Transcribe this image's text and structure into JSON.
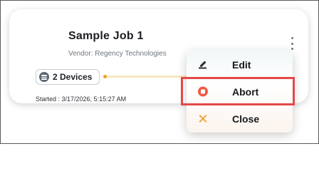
{
  "job": {
    "title": "Sample Job 1",
    "vendor": "Vendor: Regency Technologies",
    "devices_label": "2 Devices",
    "started": "Started : 3/17/2026, 5:15:27 AM",
    "progress_fraction": 0.0
  },
  "menu": {
    "items": [
      {
        "label": "Edit",
        "icon": "pencil-icon"
      },
      {
        "label": "Abort",
        "icon": "stop-circle-icon",
        "highlighted": true
      },
      {
        "label": "Close",
        "icon": "close-icon"
      }
    ]
  },
  "colors": {
    "card_shadow": "#000000",
    "progress_track": "#f6e7c1",
    "progress_fill": "#f0b24b",
    "abort_icon": "#ef5b43",
    "close_icon": "#f0a640",
    "highlight": "#e54848"
  }
}
